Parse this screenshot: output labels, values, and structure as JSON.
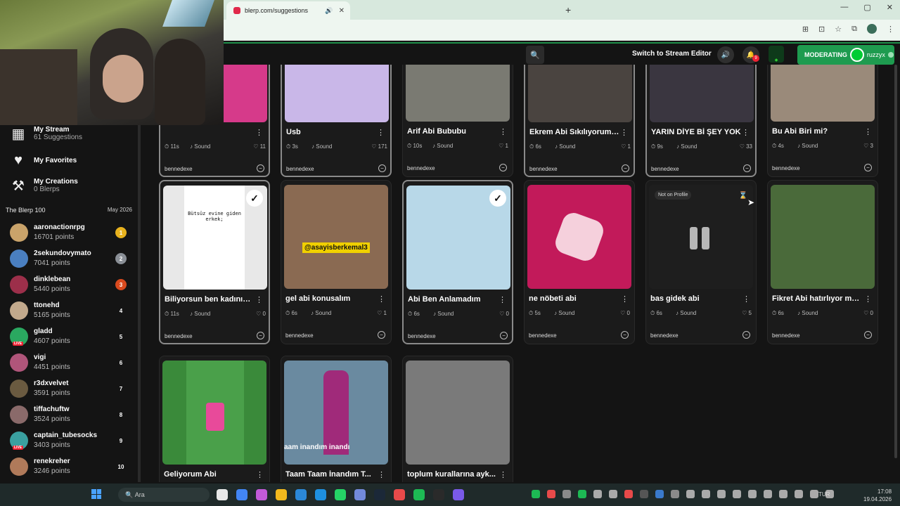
{
  "browser": {
    "tab_title": "blerp.com/suggestions",
    "new_tab": "+",
    "window_controls": [
      "—",
      "▢",
      "✕"
    ]
  },
  "appbar": {
    "switch_label": "Switch to Stream Editor",
    "notification_count": "9",
    "moderating_label": "MODERATING",
    "username": "ruzzyx"
  },
  "sidebar": {
    "items": [
      {
        "label": "My Stream",
        "sub": "61 Suggestions",
        "icon": "stream-icon"
      },
      {
        "label": "My Favorites",
        "sub": "",
        "icon": "heart-icon"
      },
      {
        "label": "My Creations",
        "sub": "0 Blerps",
        "icon": "hammer-icon"
      }
    ],
    "leaderboard_title": "The Blerp 100",
    "leaderboard_date": "May 2026",
    "leaderboard": [
      {
        "name": "aaronactionrpg",
        "points": "16701 points",
        "rank": "1",
        "rank_color": "#e8b21e",
        "avatar_color": "#c9a36a",
        "live": false
      },
      {
        "name": "2sekundovymato",
        "points": "7041 points",
        "rank": "2",
        "rank_color": "#8a8f96",
        "avatar_color": "#4a7fc0",
        "live": false
      },
      {
        "name": "dinklebean",
        "points": "5440 points",
        "rank": "3",
        "rank_color": "#d94a1e",
        "avatar_color": "#9c2f4a",
        "live": false
      },
      {
        "name": "ttonehd",
        "points": "5165 points",
        "rank": "4",
        "rank_color": "",
        "avatar_color": "#c2a98c",
        "live": false
      },
      {
        "name": "gladd",
        "points": "4607 points",
        "rank": "5",
        "rank_color": "",
        "avatar_color": "#2aa860",
        "live": true
      },
      {
        "name": "vigi",
        "points": "4451 points",
        "rank": "6",
        "rank_color": "",
        "avatar_color": "#b0557a",
        "live": false
      },
      {
        "name": "r3dxvelvet",
        "points": "3591 points",
        "rank": "7",
        "rank_color": "",
        "avatar_color": "#6a5a40",
        "live": false
      },
      {
        "name": "tiffachuftw",
        "points": "3524 points",
        "rank": "8",
        "rank_color": "",
        "avatar_color": "#8a6a6a",
        "live": false
      },
      {
        "name": "captain_tubesocks",
        "points": "3403 points",
        "rank": "9",
        "rank_color": "",
        "avatar_color": "#3aa0a0",
        "live": true
      },
      {
        "name": "renekreher",
        "points": "3246 points",
        "rank": "10",
        "rank_color": "",
        "avatar_color": "#b07a5a",
        "live": false
      }
    ]
  },
  "cards": [
    {
      "title": "",
      "duration": "11s",
      "type": "Sound",
      "likes": "11",
      "user": "bennedexe",
      "selected": true,
      "thumb": "#d63a8a",
      "check": false,
      "not_on_profile": "",
      "pause": false
    },
    {
      "title": "Usb",
      "duration": "3s",
      "type": "Sound",
      "likes": "171",
      "user": "bennedexe",
      "selected": true,
      "thumb": "#c9b7e8",
      "check": false,
      "not_on_profile": "",
      "pause": false
    },
    {
      "title": "Arif Abi Bububu",
      "duration": "10s",
      "type": "Sound",
      "likes": "1",
      "user": "bennedexe",
      "selected": false,
      "thumb": "#7a7a72",
      "check": false,
      "not_on_profile": "",
      "pause": false
    },
    {
      "title": "Ekrem Abi Sıkılıyorum ...",
      "duration": "6s",
      "type": "Sound",
      "likes": "1",
      "user": "bennedexe",
      "selected": true,
      "thumb": "#4a4440",
      "check": false,
      "not_on_profile": "",
      "pause": false
    },
    {
      "title": "YARIN DİYE Bİ ŞEY YOK",
      "duration": "9s",
      "type": "Sound",
      "likes": "33",
      "user": "bennedexe",
      "selected": true,
      "thumb": "#3a3640",
      "check": false,
      "not_on_profile": "",
      "pause": false
    },
    {
      "title": "Bu Abi Biri mi?",
      "duration": "4s",
      "type": "Sound",
      "likes": "3",
      "user": "bennedexe",
      "selected": false,
      "thumb": "#9a8a7a",
      "check": false,
      "not_on_profile": "",
      "pause": false
    },
    {
      "title": "Biliyorsun ben kadınım...",
      "duration": "11s",
      "type": "Sound",
      "likes": "0",
      "user": "bennedexe",
      "selected": true,
      "thumb": "#e8e8e8",
      "check": true,
      "not_on_profile": "",
      "pause": false
    },
    {
      "title": "gel abi konusalım",
      "duration": "6s",
      "type": "Sound",
      "likes": "1",
      "user": "bennedexe",
      "selected": false,
      "thumb": "#8a6a52",
      "check": false,
      "not_on_profile": "",
      "pause": false
    },
    {
      "title": "Abi Ben Anlamadım",
      "duration": "6s",
      "type": "Sound",
      "likes": "0",
      "user": "bennedexe",
      "selected": true,
      "thumb": "#b8d8e8",
      "check": true,
      "not_on_profile": "",
      "pause": false
    },
    {
      "title": "ne nöbeti abi",
      "duration": "5s",
      "type": "Sound",
      "likes": "0",
      "user": "bennedexe",
      "selected": false,
      "thumb": "#c21a5a",
      "check": false,
      "not_on_profile": "",
      "pause": false
    },
    {
      "title": "bas gidek abi",
      "duration": "6s",
      "type": "Sound",
      "likes": "5",
      "user": "bennedexe",
      "selected": false,
      "thumb": "#1e1e1e",
      "check": false,
      "not_on_profile": "Not on Profile",
      "pause": true
    },
    {
      "title": "Fikret Abi hatırlıyor mu...",
      "duration": "6s",
      "type": "Sound",
      "likes": "0",
      "user": "bennedexe",
      "selected": false,
      "thumb": "#4a6a3a",
      "check": false,
      "not_on_profile": "",
      "pause": false
    },
    {
      "title": "Geliyorum Abi",
      "duration": "",
      "type": "",
      "likes": "",
      "user": "",
      "selected": false,
      "thumb": "#3a8a3a",
      "check": false,
      "not_on_profile": "",
      "pause": false
    },
    {
      "title": "Taam Taam İnandım T...",
      "duration": "",
      "type": "",
      "likes": "",
      "user": "",
      "selected": false,
      "thumb": "#6a8aa0",
      "check": false,
      "not_on_profile": "",
      "pause": false
    },
    {
      "title": "toplum kurallarına ayk...",
      "duration": "",
      "type": "",
      "likes": "",
      "user": "",
      "selected": false,
      "thumb": "#7a7a7a",
      "check": false,
      "not_on_profile": "",
      "pause": false
    }
  ],
  "thumb_texts": {
    "usb_x": "✕",
    "card7_text": "Bütsüz evine giden erkek;",
    "card8_text": "@asayisberkemal3",
    "card14_text": "aam inandım inandı"
  },
  "taskbar": {
    "search_placeholder": "Ara",
    "lang": "TUR",
    "time": "17:08",
    "date": "19.04.2026"
  }
}
